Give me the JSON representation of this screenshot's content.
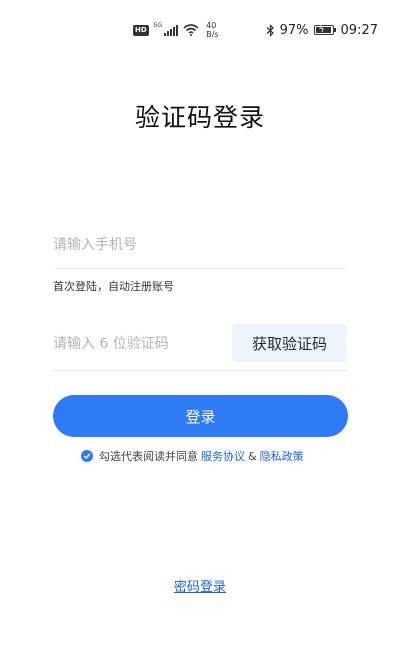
{
  "status_bar": {
    "hd_badge": "HD",
    "network": "5G",
    "speed_value": "40",
    "speed_unit": "B/s",
    "battery_percent": "97%",
    "battery_level": 0.97,
    "time": "09:27",
    "icons": [
      "hd-icon",
      "signal-icon",
      "wifi-icon",
      "bluetooth-icon",
      "battery-charging-icon"
    ]
  },
  "title": "验证码登录",
  "phone": {
    "placeholder": "请输入手机号",
    "value": "",
    "hint": "首次登陆，自动注册账号"
  },
  "code": {
    "placeholder": "请输入 6 位验证码",
    "value": "",
    "get_code_label": "获取验证码"
  },
  "login_label": "登录",
  "agreement": {
    "checked": true,
    "prefix": "勾选代表阅读并同意",
    "service_link": "服务协议",
    "and": "&",
    "privacy_link": "隐私政策"
  },
  "password_login_label": "密码登录",
  "colors": {
    "accent": "#2f7bf5",
    "link": "#1f63d8",
    "get_code_bg": "#eef4fc"
  }
}
